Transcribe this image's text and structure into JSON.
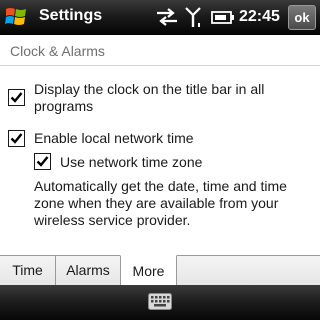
{
  "titlebar": {
    "title": "Settings",
    "time": "22:45",
    "ok_label": "ok",
    "icons": [
      "windows-start-icon",
      "network-sync-icon",
      "signal-icon",
      "battery-icon"
    ]
  },
  "section": {
    "header": "Clock & Alarms"
  },
  "options": [
    {
      "label_line1": "Display the clock on the title bar in all",
      "label_line2": "programs",
      "checked": true
    },
    {
      "label": "Enable local network time",
      "checked": true
    },
    {
      "label": "Use network time zone",
      "checked": true
    }
  ],
  "description": {
    "line1": "Automatically get the date, time and time",
    "line2": "zone when they are available from your",
    "line3": "wireless service provider."
  },
  "tabs": [
    {
      "label": "Time",
      "active": false
    },
    {
      "label": "Alarms",
      "active": false
    },
    {
      "label": "More",
      "active": true
    }
  ],
  "bottombar": {
    "icon": "keyboard-icon"
  },
  "colors": {
    "titlebar": "#1c1c1c",
    "section_header": "#6f6f6f",
    "text": "#1a1a1a"
  }
}
